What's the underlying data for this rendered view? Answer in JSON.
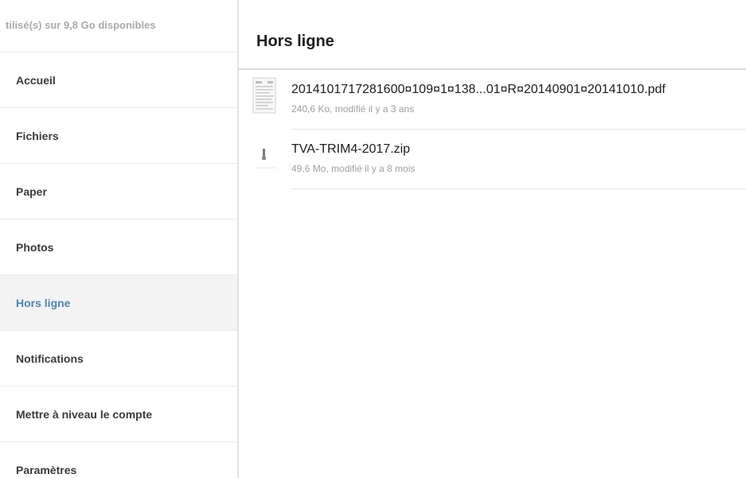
{
  "sidebar": {
    "storage_text": "tilisé(s) sur 9,8 Go disponibles",
    "items": [
      {
        "label": "Accueil"
      },
      {
        "label": "Fichiers"
      },
      {
        "label": "Paper"
      },
      {
        "label": "Photos"
      },
      {
        "label": "Hors ligne",
        "active": true
      },
      {
        "label": "Notifications"
      },
      {
        "label": "Mettre à niveau le compte"
      },
      {
        "label": "Paramètres"
      }
    ]
  },
  "main": {
    "title": "Hors ligne",
    "files": [
      {
        "name": "2014101717281600¤109¤1¤138...01¤R¤20140901¤20141010.pdf",
        "meta": "240,6 Ko, modifié il y a 3 ans",
        "icon": "pdf-document-icon"
      },
      {
        "name": "TVA-TRIM4-2017.zip",
        "meta": "49,6 Mo, modifié il y a 8 mois",
        "icon": "zip-file-icon"
      }
    ]
  },
  "colors": {
    "accent": "#4a86b5",
    "active_bg": "#f3f3f3",
    "divider": "#e6e6e6",
    "muted_text": "#9e9e9e"
  }
}
